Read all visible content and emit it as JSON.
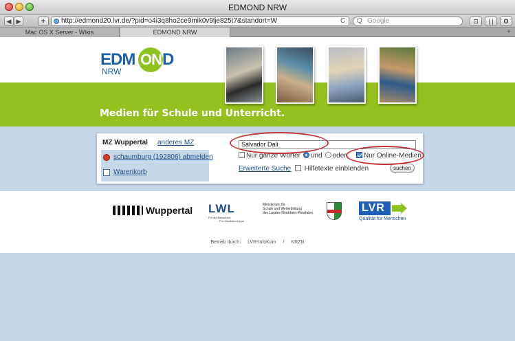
{
  "window": {
    "title": "EDMOND NRW"
  },
  "toolbar": {
    "back_icon": "back-arrow-icon",
    "forward_icon": "forward-arrow-icon",
    "add_label": "+",
    "url": "http://edmond20.lvr.de/?pid=o4i3q8ho2ce9mik0v9lje825t7&standort=W",
    "reload_label": "C",
    "search_placeholder": "Google",
    "search_icon_label": "Q",
    "btn_bookmark_label": "⊡",
    "btn_pause_label": "| |",
    "btn_stop_label": "O"
  },
  "tabs": [
    {
      "label": "Mac OS X Server - Wikis"
    },
    {
      "label": "EDMOND NRW"
    }
  ],
  "tab_add_label": "+",
  "logo": {
    "part1": "EDM",
    "part2": "ON",
    "part3": "D",
    "sub": "NRW"
  },
  "slogan": "Medien für Schule und Unterricht.",
  "panel": {
    "mz_label": "MZ Wuppertal",
    "mz_link": "anderes MZ",
    "logout_link": "schaumburg (192806) abmelden",
    "cart_link": "Warenkorb",
    "search_value": "Salvador Dali",
    "whole_words_label": "Nur ganze Wörter",
    "and_label": "und",
    "or_label": "oder",
    "online_label": "Nur Online-Medien",
    "advanced_link": "Erweiterte Suche",
    "help_label": "Hilfetexte einblenden",
    "search_button": "suchen"
  },
  "footer": {
    "wuppertal_label": "Wuppertal",
    "lwl_label": "LWL",
    "lwl_sub1": "Für die Menschen.",
    "lwl_sub2": "Für Westfalen-Lippe.",
    "ministry_line1": "Ministerium für",
    "ministry_line2": "Schule und Weiterbildung",
    "ministry_line3": "des Landes Nordrhein-Westfalen",
    "lvr_label": "LVR",
    "lvr_tag": "Qualität für Menschen",
    "operated_label": "Betrieb durch:",
    "operator1": "LVR-InfoKom",
    "separator": "/",
    "operator2": "KRZN"
  },
  "colors": {
    "green": "#94c11f",
    "blue_band": "#c6d7e8",
    "link": "#1e4f8c",
    "highlight_red": "#c2333a"
  }
}
